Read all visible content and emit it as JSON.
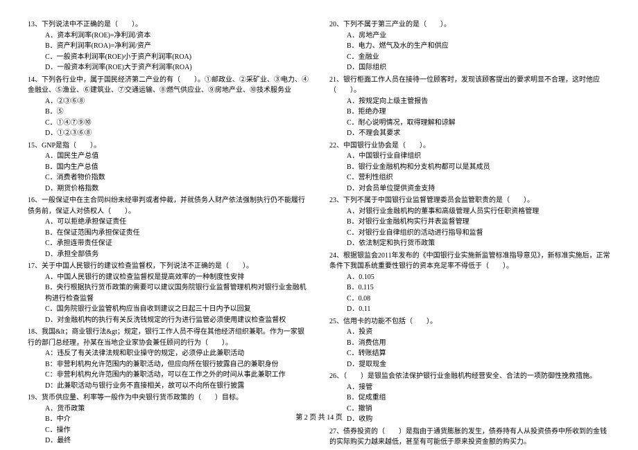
{
  "footer": "第 2 页 共 14 页",
  "left": {
    "q13": {
      "stem": "13、下列说法中不正确的是（　　）。",
      "opts": [
        "A．资本利润率(ROE)=净利润/资本",
        "B．资产利润率(ROA)=净利润/资产",
        "C．一般资本利润率(ROE)小于资产利润率(ROA)",
        "D．一般资本利润率(ROE)大于资产利润率(ROA)"
      ]
    },
    "q14": {
      "stem": "14、下列各行业中，属于国民经济第二产业的有（　　）。①邮政业、②采矿业、③电力、④金融业、⑤渔业、⑥建筑业、⑦交通运输、⑧燃气供应业、⑨房地产业、⑩技术服务业",
      "opts": [
        "A．②③⑥⑧",
        "B．⑤",
        "C．①④⑦⑨⑩",
        "D．①②③⑥⑧"
      ]
    },
    "q15": {
      "stem": "15、GNP是指（　　）。",
      "opts": [
        "A．国民生产总值",
        "B．国内生产总值",
        "C．消费者物价指数",
        "D．期货价格指数"
      ]
    },
    "q16": {
      "stem": "16、一般保证中在主合同纠纷未经审判或者仲裁，并就债务人财产依法强制执行仍不能履行债务前，保证人对债权人（　　）。",
      "opts": [
        "A．可以拒绝承担保证责任",
        "B．在保证范围内承担保证责任",
        "C．承担连带责任保证",
        "D．承担全部债务"
      ]
    },
    "q17": {
      "stem": "17、关于中国人民银行的建议检查监督权，下列说法不正确的是（　　）。",
      "opts": [
        "A．中国人民银行的建议检查监督权是提高效率的一种制度性安排",
        "B．央行根据执行货币政策的需要可以建议国务院银行业监督管理机构对银行业金融机构进行检查监督",
        "C．国务院银行业监管机构应当自收到建议之日起三十日内予以回复",
        "D．对金融机构的执行有关反洗钱规定的行为进行监管必须使用建议检查监督权"
      ]
    },
    "q18": {
      "stem": "18、我国&lt；商业银行法&gt；规定，银行工作人员不得在其他经济组织兼职。作为一家银行的部门总经理，孙某在当地企业家协会兼任顾问的行为（　　）。",
      "opts": [
        "A：违反了有关法律法规和职业操守的规定，必须停止此兼职活动",
        "B：非营利机构允许范围内的兼职活动，但应向所在银行披露自己的兼职身份",
        "C：非营利机构允许范围内的兼职活动，可以在工作之外的时间从事此兼职工作",
        "D：此兼职活动与银行业务不直接相关，故可以不向所在银行披露"
      ]
    },
    "q19": {
      "stem": "19、货币供应量、利率等一般作为中央银行货币政策的（　　）目标。",
      "opts": [
        "A．货币政策",
        "B．中介",
        "C．操作",
        "D．最终"
      ]
    }
  },
  "right": {
    "q20": {
      "stem": "20、下列不属于第三产业的是（　　）。",
      "opts": [
        "A．房地产业",
        "B．电力、燃气及水的生产和供应",
        "C．金融业",
        "D．国际组织"
      ]
    },
    "q21": {
      "stem": "21、银行柜面工作人员在接待一位顾客时，发现该顾客提出的要求明显不合理，这时他应（　　）。",
      "opts": [
        "A．按规定向上级主管报告",
        "B．拒绝办理",
        "C．耐心说明情况，取得理解和谅解",
        "D．不理会其要求"
      ]
    },
    "q22": {
      "stem": "22、中国银行业协会是（　　）。",
      "opts": [
        "A．中国银行业自律组织",
        "B．银行业金融机构和分支机构都可以是其成员",
        "C．营利性组织",
        "D．对会员单位提供资金支持"
      ]
    },
    "q23": {
      "stem": "23、下列不属于中国银行业监督管理委员会监管职责的是（　　）。",
      "opts": [
        "A．对银行业金融机构的董事和高级管理人员实行任职资格管理",
        "B．对银行业金融机构实行并表监督管理",
        "C．对银行业自律组织的活动进行指导和监督",
        "D．依法制定和执行货币政策"
      ]
    },
    "q24": {
      "stem": "24、根据银监会2011年发布的《中国银行业实施新监管标准指导意见》，新标准实施后，正常条件下我国系统重要性银行的资本充足率不得低于（　　）。",
      "opts": [
        "A．0.105",
        "B．0.115",
        "C．0.08",
        "D．0.11"
      ]
    },
    "q25": {
      "stem": "25、信用卡的功能不包括（　　）。",
      "opts": [
        "A．投资",
        "B．消费信用",
        "C．转账结算",
        "D．提取现金"
      ]
    },
    "q26": {
      "stem": "26、（　　）是银监会依法保护银行业金融机构经营安全、合法的一项防御性挽救措施。",
      "opts": [
        "A．接管",
        "B．促成重组",
        "C．撤销",
        "D．收购"
      ]
    },
    "q27": {
      "stem": "27、债券投资的（　　）是指由于通货膨胀的发生，债券持有人从投资债券中所收到的金钱的实际购买力越来越低，甚至有可能低于原来投资金额的购买力。"
    }
  }
}
